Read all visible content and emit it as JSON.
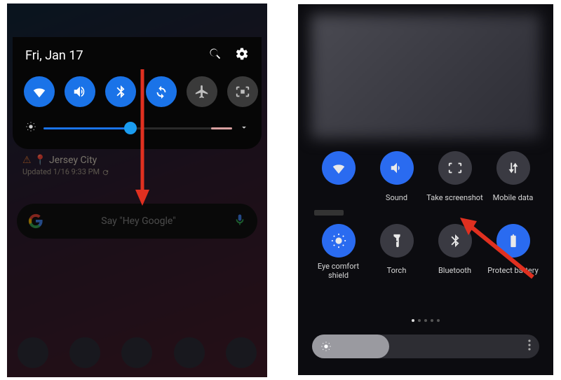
{
  "left": {
    "date": "Fri, Jan 17",
    "tiles": [
      {
        "name": "wifi",
        "on": true
      },
      {
        "name": "sound",
        "on": true
      },
      {
        "name": "bluetooth",
        "on": true
      },
      {
        "name": "autorotate",
        "on": true
      },
      {
        "name": "airplane",
        "on": false
      },
      {
        "name": "screenrecord",
        "on": false
      }
    ],
    "brightness_pct": 46,
    "weather": {
      "location": "Jersey City",
      "updated": "Updated 1/16 9:33 PM"
    },
    "google_bar": {
      "hint": "Say \"Hey Google\""
    }
  },
  "right": {
    "row1": [
      {
        "name": "wifi",
        "label": "",
        "on": true
      },
      {
        "name": "sound",
        "label": "Sound",
        "on": true
      },
      {
        "name": "screenshot",
        "label": "Take screenshot",
        "on": false
      },
      {
        "name": "mobiledata",
        "label": "Mobile data",
        "on": false
      }
    ],
    "row2": [
      {
        "name": "eyecomfort",
        "label": "Eye comfort shield",
        "on": true
      },
      {
        "name": "torch",
        "label": "Torch",
        "on": false
      },
      {
        "name": "bluetooth",
        "label": "Bluetooth",
        "on": false
      },
      {
        "name": "protectbattery",
        "label": "Protect battery",
        "on": true
      }
    ],
    "page_count": 5,
    "page_active": 0,
    "brightness_pct": 34
  }
}
